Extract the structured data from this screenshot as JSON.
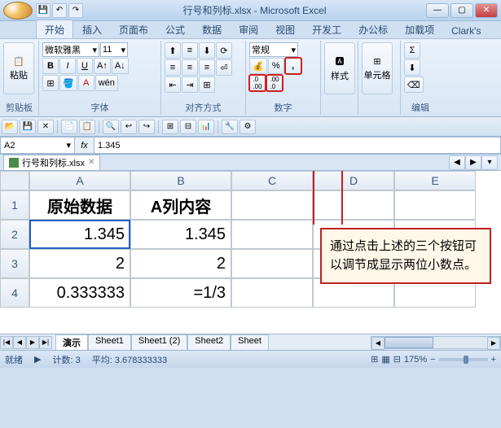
{
  "title": "行号和列标.xlsx - Microsoft Excel",
  "tabs": [
    "开始",
    "插入",
    "页面布",
    "公式",
    "数据",
    "审阅",
    "视图",
    "开发工",
    "办公标",
    "加载项",
    "Clark's"
  ],
  "active_tab": 0,
  "ribbon": {
    "clipboard": {
      "label": "剪贴板",
      "paste": "粘贴"
    },
    "font": {
      "label": "字体",
      "name": "微软雅黑",
      "size": "11"
    },
    "align": {
      "label": "对齐方式"
    },
    "number": {
      "label": "数字",
      "format": "常规"
    },
    "style": {
      "label": "样式",
      "btn": "样式"
    },
    "cells": {
      "label": "单元格",
      "btn": "单元格"
    },
    "edit": {
      "label": "编辑"
    }
  },
  "namebox": "A2",
  "formula": "1.345",
  "workbook_tab": "行号和列标.xlsx",
  "columns": [
    "A",
    "B",
    "C",
    "D",
    "E"
  ],
  "rows": [
    {
      "n": "1",
      "a": "原始数据",
      "b": "A列内容"
    },
    {
      "n": "2",
      "a": "1.345",
      "b": "1.345"
    },
    {
      "n": "3",
      "a": "2",
      "b": "2"
    },
    {
      "n": "4",
      "a": "0.333333",
      "b": "=1/3"
    }
  ],
  "callout": "通过点击上述的三个按钮可以调节成显示两位小数点。",
  "sheets": [
    "演示",
    "Sheet1",
    "Sheet1 (2)",
    "Sheet2",
    "Sheet"
  ],
  "active_sheet": 0,
  "status": {
    "ready": "就绪",
    "count_lbl": "计数:",
    "count": "3",
    "avg_lbl": "平均:",
    "avg": "3.678333333",
    "view_icons": "",
    "zoom": "175%"
  }
}
